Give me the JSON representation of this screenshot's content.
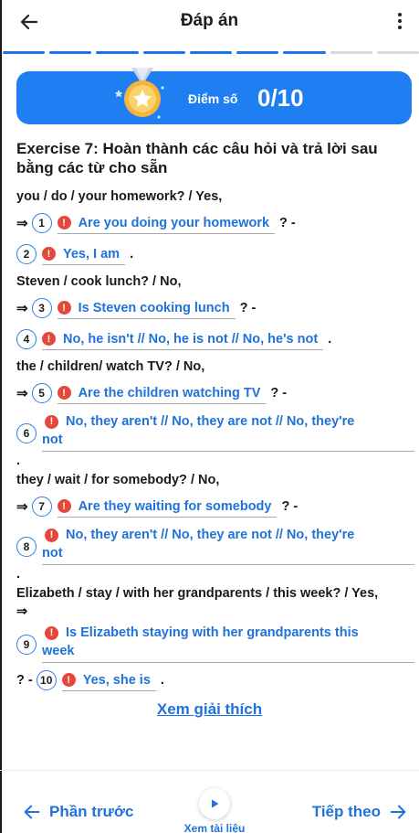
{
  "header": {
    "title": "Đáp án"
  },
  "progress": {
    "total": 9,
    "completed": 7
  },
  "score": {
    "label": "Điểm số",
    "value": "0/10"
  },
  "exercise": {
    "title": "Exercise 7: Hoàn thành các câu hỏi và trả lời sau bằng các từ cho sẵn",
    "items": [
      {
        "prompt": "you / do / your homework? / Yes,",
        "q_num": "1",
        "q_answer": "Are you doing your homework",
        "q_tail": "? -",
        "a_num": "2",
        "a_answer": "Yes, I am",
        "a_tail": "."
      },
      {
        "prompt": "Steven / cook lunch? / No,",
        "q_num": "3",
        "q_answer": "Is Steven cooking lunch",
        "q_tail": "? -",
        "a_num": "4",
        "a_answer": "No, he isn't // No, he is not // No, he's not",
        "a_tail": "."
      },
      {
        "prompt": "the / children/ watch TV? / No,",
        "q_num": "5",
        "q_answer": "Are the children watching TV",
        "q_tail": "? -",
        "a_num": "6",
        "a_answer_line1": "No, they aren't // No, they are not // No, they're",
        "a_answer_line2": "not",
        "a_tail": "."
      },
      {
        "prompt": "they / wait / for somebody? / No,",
        "q_num": "7",
        "q_answer": "Are they waiting for somebody",
        "q_tail": "? -",
        "a_num": "8",
        "a_answer_line1": "No, they aren't // No, they are not // No, they're",
        "a_answer_line2": "not",
        "a_tail": "."
      },
      {
        "prompt": "Elizabeth / stay / with her grandparents / this week? / Yes,",
        "q_num": "9",
        "q_answer_line1": "Is Elizabeth staying with her grandparents this",
        "q_answer_line2": "week",
        "a_prefix": "? -",
        "a_num": "10",
        "a_answer": "Yes, she is",
        "a_tail": "."
      }
    ]
  },
  "explain_link": "Xem giải thích",
  "footer": {
    "prev_label": "Phần trước",
    "next_label": "Tiếp theo",
    "doc_label": "Xem tài liệu"
  },
  "icons": {
    "back": "arrow-left-icon",
    "more": "more-vertical-icon",
    "warning": "exclamation-icon",
    "play": "play-icon",
    "medal": "medal-icon"
  },
  "colors": {
    "accent": "#1e7ef2",
    "answer": "#1f72d8",
    "wrong": "#e5473a"
  }
}
